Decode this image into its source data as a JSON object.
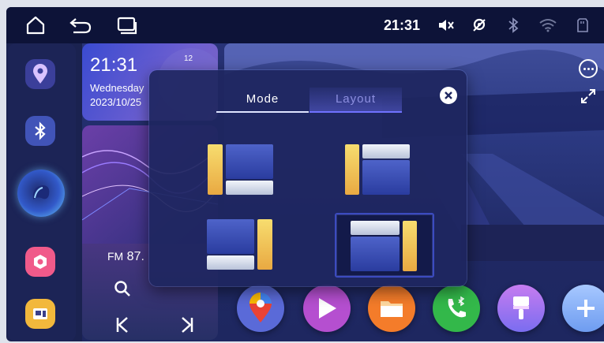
{
  "status_bar": {
    "time": "21:31",
    "icons": [
      "home-icon",
      "back-icon",
      "recent-apps-icon",
      "mute-icon",
      "gps-icon",
      "bluetooth-icon",
      "wifi-icon",
      "sd-card-icon"
    ]
  },
  "clock_widget": {
    "time": "21:31",
    "day": "Wednesday",
    "date": "2023/10/25",
    "dial_label": "12"
  },
  "radio_widget": {
    "band": "FM",
    "frequency": "87."
  },
  "dialog": {
    "tabs": [
      {
        "label": "Mode",
        "active": true
      },
      {
        "label": "Layout",
        "active": false
      }
    ],
    "selected_layout": 4
  },
  "colors": {
    "accent_gold": "#f0c45a",
    "accent_blue": "#3a4fc0",
    "tab_active_line": "#dfe5ff",
    "tab_inactive_text": "#8d8fe0"
  },
  "sidebar": {
    "apps": [
      "map-pin-icon",
      "bluetooth-icon",
      "voice-assistant-icon",
      "settings-icon",
      "widgets-icon"
    ]
  },
  "dock": {
    "apps": [
      "google-maps-icon",
      "play-store-icon",
      "files-icon",
      "bluetooth-phone-icon",
      "paint-icon",
      "add-icon"
    ]
  }
}
